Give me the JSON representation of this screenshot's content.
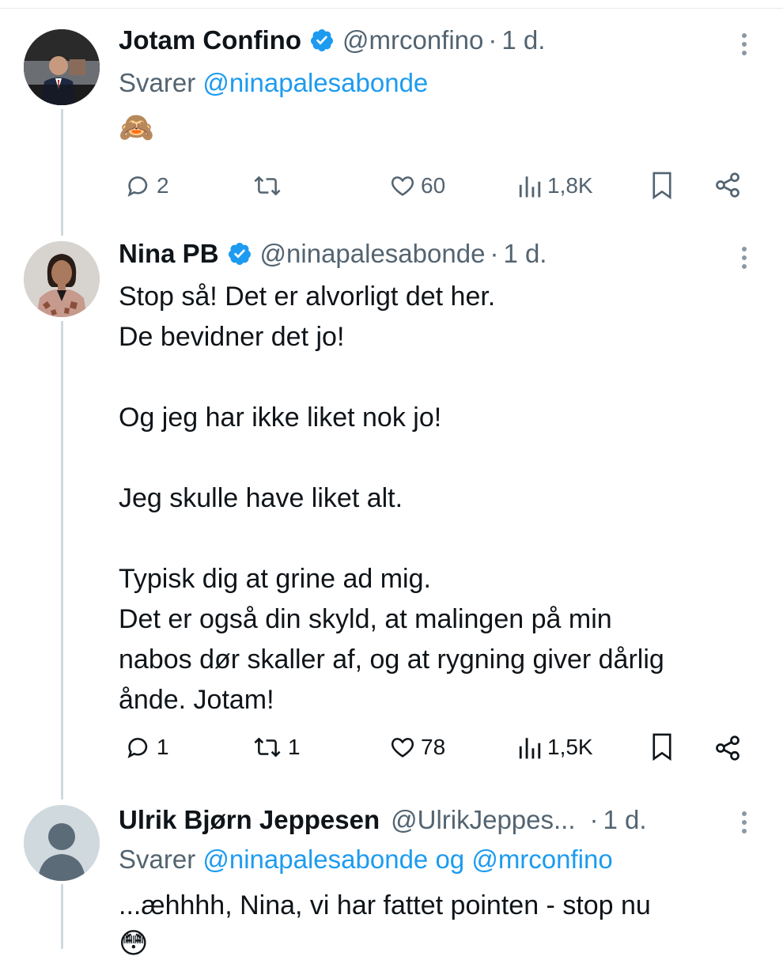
{
  "tweets": [
    {
      "display_name": "Jotam Confino",
      "handle": "@mrconfino",
      "separator": "·",
      "time": "1 d.",
      "reply_prefix": "Svarer",
      "reply_mentions": "@ninapalesabonde",
      "text": "🙈",
      "actions": {
        "replies": "2",
        "retweets": "",
        "likes": "60",
        "views": "1,8K"
      }
    },
    {
      "display_name": "Nina PB",
      "handle": "@ninapalesabonde",
      "separator": "·",
      "time": "1 d.",
      "text": "Stop så! Det er alvorligt det her.\nDe bevidner det jo!\n\nOg jeg har ikke liket nok jo!\n\nJeg skulle have liket alt.\n\nTypisk dig at grine ad mig.\nDet er også din skyld, at malingen på min\nnabos dør skaller af, og at rygning giver dårlig\nånde. Jotam!",
      "actions": {
        "replies": "1",
        "retweets": "1",
        "likes": "78",
        "views": "1,5K"
      }
    },
    {
      "display_name": "Ulrik Bjørn Jeppesen",
      "handle": "@UlrikJeppes...",
      "separator": "·",
      "time": "1 d.",
      "reply_prefix": "Svarer",
      "reply_mentions": "@ninapalesabonde og @mrconfino",
      "text": "...æhhhh, Nina, vi har fattet pointen - stop nu",
      "emoji_partial": "😳"
    }
  ],
  "colors": {
    "accent": "#1d9bf0",
    "secondary_text": "#536471",
    "thread_line": "#cfd9de",
    "primary_text": "#0f1419"
  }
}
